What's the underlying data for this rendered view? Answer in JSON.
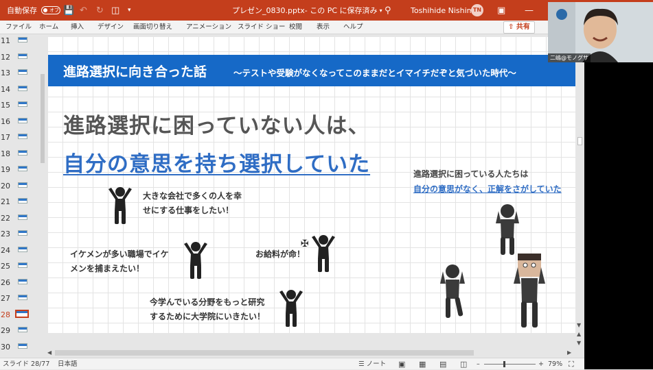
{
  "titlebar": {
    "autosave_label": "自動保存",
    "autosave_state": "オフ",
    "filename": "プレゼン_0830.pptx",
    "save_status": " - この PC に保存済み",
    "user_name": "Toshihide Nishima",
    "user_initials": "TN"
  },
  "ribbon": {
    "tabs": [
      "ファイル",
      "ホーム",
      "挿入",
      "デザイン",
      "画面切り替え",
      "アニメーション",
      "スライド ショー",
      "校閲",
      "表示",
      "ヘルプ"
    ],
    "share_label": "共有"
  },
  "thumbnails": {
    "numbers": [
      "11",
      "12",
      "13",
      "14",
      "15",
      "16",
      "17",
      "18",
      "19",
      "20",
      "21",
      "22",
      "23",
      "24",
      "25",
      "26",
      "27",
      "28",
      "29",
      "30"
    ],
    "active": "28"
  },
  "slide": {
    "title": "進路選択に向き合った話",
    "subtitle": "～テストや受験がなくなってこのままだとイマイチだぞと気づいた時代～",
    "headline1": "進路選択に困っていない人は、",
    "headline2": "自分の意思を持ち選択していた",
    "right_line1": "進路選択に困っている人たちは",
    "right_line2": "自分の意思がなく、正解をさがしていた",
    "caption1_line1": "大きな会社で多くの人を幸",
    "caption1_line2": "せにする仕事をしたい！",
    "caption2_line1": "イケメンが多い職場でイケ",
    "caption2_line2": "メンを捕まえたい！",
    "caption3": "お給料が命！",
    "caption4_line1": "今学んでいる分野をもっと研究",
    "caption4_line2": "するために大学院にいきたい！"
  },
  "statusbar": {
    "slide_counter": "スライド 28/77",
    "language": "日本語",
    "notes_label": "ノート",
    "zoom": "79%"
  },
  "webcam": {
    "name_label": "二嶋@モノグサ"
  },
  "colors": {
    "accent": "#c43e1c",
    "banner": "#1669c7",
    "emphasis": "#2f6dc4"
  }
}
